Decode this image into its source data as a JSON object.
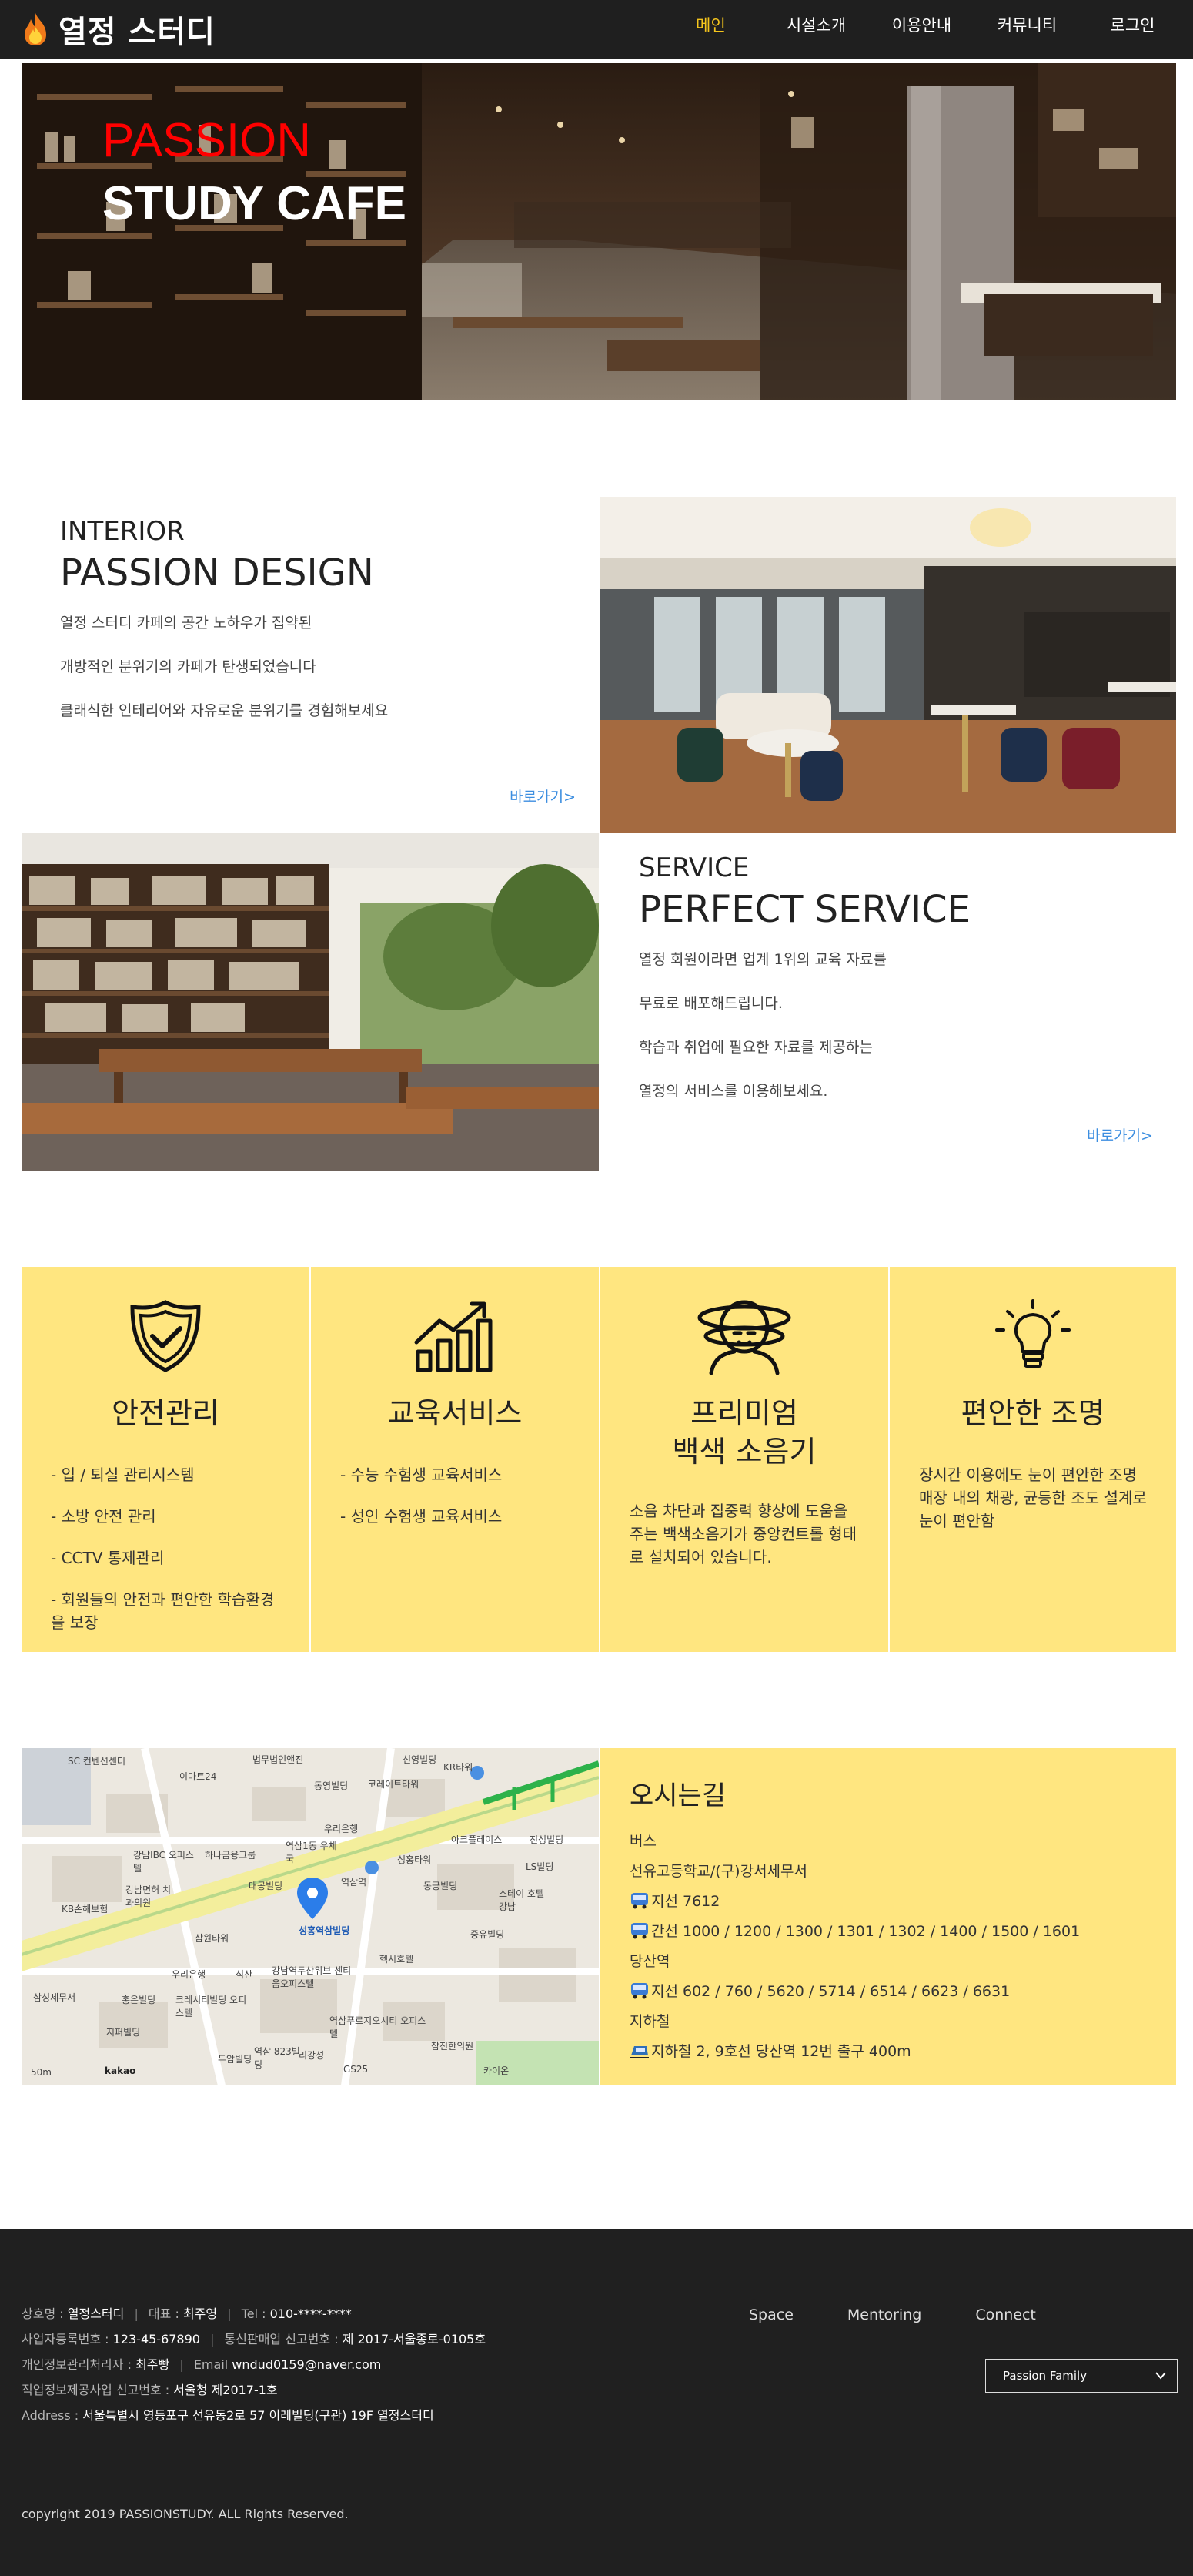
{
  "header": {
    "brand": "열정 스터디",
    "nav": [
      "메인",
      "시설소개",
      "이용안내",
      "커뮤니티",
      "로그인"
    ]
  },
  "hero": {
    "title_line1": "PASSION",
    "title_line2": "STUDY CAFE"
  },
  "interior": {
    "sub": "INTERIOR",
    "title": "PASSION DESIGN",
    "lines": [
      "열정 스터디 카페의 공간 노하우가 집약된",
      "개방적인 분위기의 카페가 탄생되었습니다",
      "클래식한 인테리어와 자유로운 분위기를 경험해보세요"
    ],
    "more": "바로가기>"
  },
  "service": {
    "sub": "SERVICE",
    "title": "PERFECT SERVICE",
    "lines": [
      "열정 회원이라면 업계 1위의 교육 자료를",
      "무료로 배포해드립니다.",
      "학습과 취업에 필요한 자료를 제공하는",
      "열정의 서비스를 이용해보세요."
    ],
    "more": "바로가기>"
  },
  "features": [
    {
      "icon": "shield-check-icon",
      "title": "안전관리",
      "items": [
        "- 입 / 퇴실 관리시스템",
        "- 소방 안전 관리",
        "- CCTV 통제관리",
        "- 회원들의 안전과 편안한 학습환경을 보장"
      ]
    },
    {
      "icon": "growth-chart-icon",
      "title": "교육서비스",
      "items": [
        "- 수능 수험생 교육서비스",
        "- 성인 수험생 교육서비스"
      ]
    },
    {
      "icon": "headphones-person-icon",
      "title_line1": "프리미엄",
      "title_line2": "백색 소음기",
      "text": "소음 차단과 집중력 향상에 도움을 주는 백색소음기가 중앙컨트롤 형태로 설치되어 있습니다."
    },
    {
      "icon": "light-bulb-icon",
      "title": "편안한 조명",
      "text": "장시간 이용에도 눈이 편안한 조명 매장 내의 채광, 균등한 조도 설계로 눈이 편안함"
    }
  ],
  "directions": {
    "title": "오시는길",
    "lines": [
      {
        "icon": "",
        "text": "버스"
      },
      {
        "icon": "",
        "text": "선유고등학교/(구)강서세무서"
      },
      {
        "icon": "bus-icon",
        "text": "지선 7612"
      },
      {
        "icon": "bus-icon",
        "text": "간선 1000 / 1200 / 1300 / 1301 / 1302 / 1400 / 1500 / 1601"
      },
      {
        "icon": "",
        "text": "당산역"
      },
      {
        "icon": "bus-icon",
        "text": "지선 602 / 760 / 5620 / 5714 / 6514 / 6623 / 6631"
      },
      {
        "icon": "",
        "text": "지하철"
      },
      {
        "icon": "subway-icon",
        "text": "지하철 2, 9호선 당산역 12번 출구 400m"
      }
    ]
  },
  "map": {
    "labels": [
      "SC 컨벤션센터",
      "이마트24",
      "법무법인앤진",
      "신영빌딩",
      "동영빌딩",
      "코레이트타워",
      "KR타워",
      "우리은행",
      "아크플레이스",
      "진성빌딩",
      "강남IBC 오피스텔",
      "하나금융그룹",
      "역삼1동 우체국",
      "LS빌딩",
      "강남면허 치과의원",
      "대공빌딩",
      "성홍타워",
      "동궁빌딩",
      "KB손해보험",
      "삼원타워",
      "역삼역",
      "스테이 호텔강남",
      "우리은행",
      "식산",
      "강남역두산위브 센티움오피스텔",
      "헥시호텔",
      "중유빌딩",
      "크레시티빌딩 오피스텔",
      "역삼푸르지오시티 오피스텔",
      "삼성세무서",
      "홍은빌딩",
      "지퍼빌딩",
      "두암빌딩",
      "역삼 823빌딩",
      "리강성",
      "GS25",
      "참진한의원",
      "카이온",
      "kakao",
      "50m"
    ],
    "pin_label": "성홍역삼빌딩"
  },
  "footer": {
    "company_label": "상호명 :",
    "company": "열정스터디",
    "ceo_label": "대표 :",
    "ceo": "최주영",
    "tel_label": "Tel :",
    "tel": "010-****-****",
    "bizno_label": "사업자등록번호 :",
    "bizno": "123-45-67890",
    "mailorder_label": "통신판매업 신고번호 :",
    "mailorder": "제 2017-서울종로-0105호",
    "privacy_label": "개인정보관리처리자 :",
    "privacy": "최주빵",
    "email_label": "Email",
    "email": "wndud0159@naver.com",
    "jobinfo_label": "직업정보제공사업 신고번호 :",
    "jobinfo": "서울청 제2017-1호",
    "address_label": "Address :",
    "address": "서울특별시 영등포구 선유동2로 57 이레빌딩(구관) 19F 열정스터디",
    "links": [
      "Space",
      "Mentoring",
      "Connect"
    ],
    "family_select": "Passion Family",
    "copyright": "copyright 2019 PASSIONSTUDY. ALL Rights Reserved."
  },
  "colors": {
    "accent_yellow": "#f5c51c",
    "feature_bg": "#ffe680",
    "link_blue": "#3c8ee0",
    "hero_red": "#ff0000",
    "dark_bg": "#202020"
  }
}
